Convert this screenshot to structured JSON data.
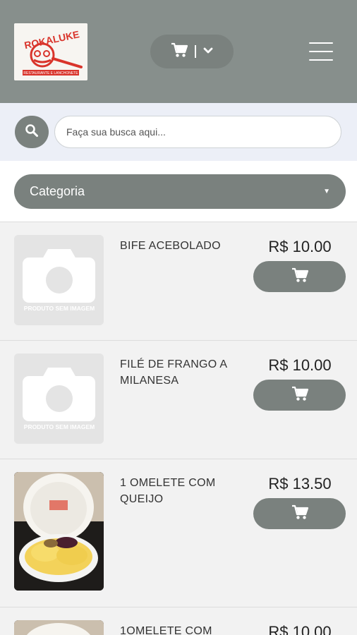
{
  "brand": {
    "name": "ROKALUKE",
    "tagline": "RESTAURANTE E LANCHONETE"
  },
  "search": {
    "placeholder": "Faça sua busca aqui..."
  },
  "category": {
    "label": "Categoria"
  },
  "placeholder_image": {
    "caption": "PRODUTO SEM IMAGEM"
  },
  "products": [
    {
      "name": "BIFE ACEBOLADO",
      "price": "R$ 10.00",
      "image": "placeholder"
    },
    {
      "name": "FILÉ DE FRANGO A MILANESA",
      "price": "R$ 10.00",
      "image": "placeholder"
    },
    {
      "name": "1 OMELETE COM QUEIJO",
      "price": "R$ 13.50",
      "image": "photo"
    },
    {
      "name": "1OMELETE COM",
      "price": "R$ 10.00",
      "image": "photo"
    }
  ],
  "colors": {
    "header": "#878f8c",
    "accent": "#7a817e",
    "search_band": "#eceff7",
    "brand_red": "#d9342b"
  },
  "icons": [
    "cart-icon",
    "chevron-down-icon",
    "menu-icon",
    "search-icon",
    "camera-icon"
  ]
}
